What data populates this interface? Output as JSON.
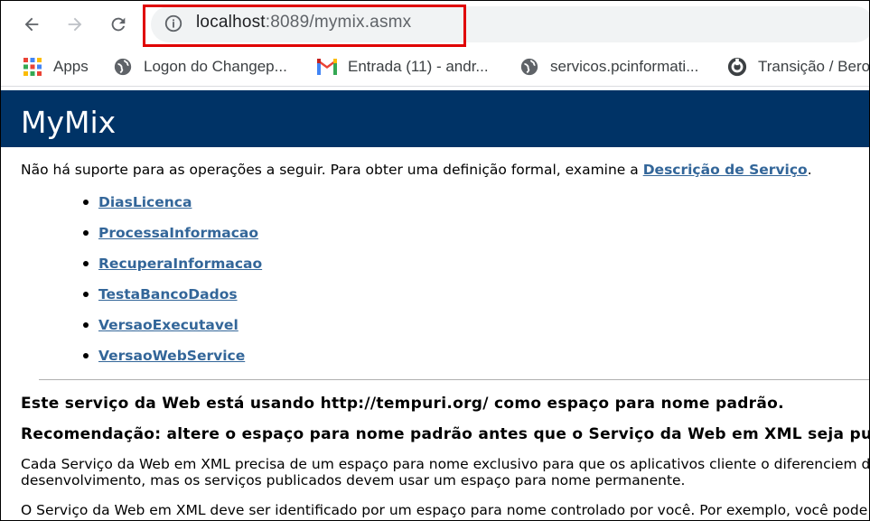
{
  "browser": {
    "url_host": "localhost",
    "url_path": ":8089/mymix.asmx",
    "bookmarks": [
      {
        "label": "Apps",
        "icon": "apps-grid-icon"
      },
      {
        "label": "Logon do Changep...",
        "icon": "globe-icon"
      },
      {
        "label": "Entrada (11) - andr...",
        "icon": "gmail-icon"
      },
      {
        "label": "servicos.pcinformati...",
        "icon": "globe-icon"
      },
      {
        "label": "Transição / Bero",
        "icon": "shield-icon"
      }
    ],
    "highlight_color": "#e00000"
  },
  "page": {
    "title": "MyMix",
    "banner_color": "#003366",
    "link_color": "#336699",
    "intro_text": "Não há suporte para as operações a seguir. Para obter uma definição formal, examine a ",
    "intro_link": "Descrição de Serviço",
    "intro_end": ".",
    "operations": [
      "DiasLicenca",
      "ProcessaInformacao",
      "RecuperaInformacao",
      "TestaBancoDados",
      "VersaoExecutavel",
      "VersaoWebService"
    ],
    "namespace_notice": "Este serviço da Web está usando http://tempuri.org/ como espaço para nome padrão.",
    "recommendation": "Recomendação: altere o espaço para nome padrão antes que o Serviço da Web em XML seja publicad",
    "para1_line1": "Cada Serviço da Web em XML precisa de um espaço para nome exclusivo para que os aplicativos cliente o diferenciem de o",
    "para1_line2": "desenvolvimento, mas os serviços publicados devem usar um espaço para nome permanente.",
    "para2": "O Serviço da Web em XML deve ser identificado por um espaço para nome controlado por você. Por exemplo, você pode us"
  }
}
